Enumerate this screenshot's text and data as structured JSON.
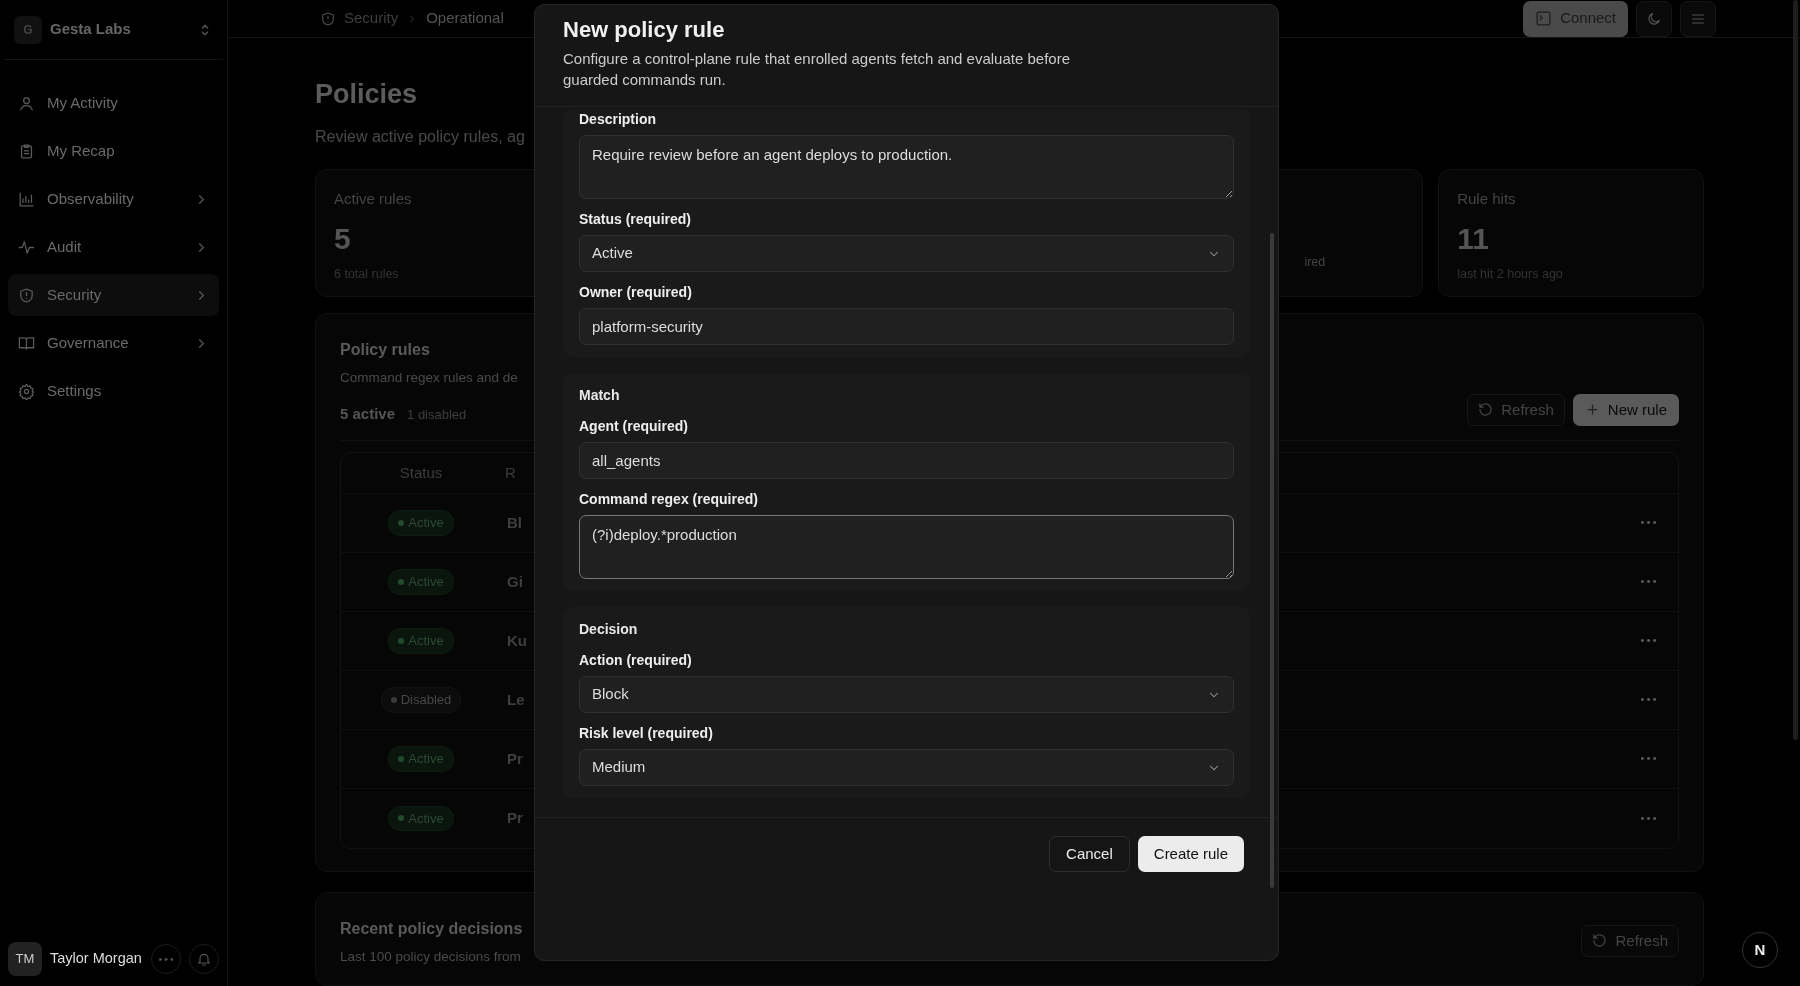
{
  "sidebar": {
    "workspace": {
      "initial": "G",
      "name": "Gesta Labs"
    },
    "items": [
      {
        "label": "My Activity",
        "selected": false,
        "has_submenu": false
      },
      {
        "label": "My Recap",
        "selected": false,
        "has_submenu": false
      },
      {
        "label": "Observability",
        "selected": false,
        "has_submenu": true
      },
      {
        "label": "Audit",
        "selected": false,
        "has_submenu": true
      },
      {
        "label": "Security",
        "selected": true,
        "has_submenu": true
      },
      {
        "label": "Governance",
        "selected": false,
        "has_submenu": true
      },
      {
        "label": "Settings",
        "selected": false,
        "has_submenu": false
      }
    ],
    "user": {
      "initials": "TM",
      "name": "Taylor Morgan"
    }
  },
  "header": {
    "breadcrumb": [
      "Security",
      "Operational"
    ],
    "connect_label": "Connect"
  },
  "page": {
    "title": "Policies",
    "subtitle": "Review active policy rules, ag"
  },
  "stats": [
    {
      "label": "Active rules",
      "value": "5",
      "note": "6 total rules"
    },
    {
      "note": "ired"
    },
    {
      "label": "Rule hits",
      "value": "11",
      "note": "last hit 2 hours ago"
    }
  ],
  "policy_rules": {
    "title": "Policy rules",
    "subtitle": "Command regex rules and de",
    "active_count": "5 active",
    "disabled_count": "1 disabled",
    "buttons": [
      {
        "label": "Refresh",
        "kind": "refresh"
      },
      {
        "label": "New rule",
        "kind": "add"
      }
    ],
    "columns": [
      "Status",
      "R"
    ],
    "rows": [
      {
        "status": "Active",
        "enabled": true,
        "rule": "Bl"
      },
      {
        "status": "Active",
        "enabled": true,
        "rule": "Gi"
      },
      {
        "status": "Active",
        "enabled": true,
        "rule": "Ku"
      },
      {
        "status": "Disabled",
        "enabled": false,
        "rule": "Le"
      },
      {
        "status": "Active",
        "enabled": true,
        "rule": "Pr"
      },
      {
        "status": "Active",
        "enabled": true,
        "rule": "Pr"
      }
    ]
  },
  "recent_decisions": {
    "title": "Recent policy decisions",
    "subtitle": "Last 100 policy decisions from",
    "button": "Refresh"
  },
  "modal": {
    "title": "New policy rule",
    "description": "Configure a control-plane rule that enrolled agents fetch and evaluate before guarded commands run.",
    "sections": [
      {
        "fields": [
          {
            "label": "Description",
            "kind": "textarea",
            "value": "Require review before an agent deploys to production.",
            "focused": false
          },
          {
            "label": "Status (required)",
            "kind": "select",
            "value": "Active",
            "focused": false
          },
          {
            "label": "Owner (required)",
            "kind": "input",
            "value": "platform-security",
            "focused": false
          }
        ]
      },
      {
        "title": "Match",
        "fields": [
          {
            "label": "Agent (required)",
            "kind": "input",
            "value": "all_agents",
            "focused": false
          },
          {
            "label": "Command regex (required)",
            "kind": "textarea",
            "value": "(?i)deploy.*production",
            "focused": true
          }
        ]
      },
      {
        "title": "Decision",
        "fields": [
          {
            "label": "Action (required)",
            "kind": "select",
            "value": "Block",
            "focused": false
          },
          {
            "label": "Risk level (required)",
            "kind": "select",
            "value": "Medium",
            "focused": false
          }
        ]
      }
    ],
    "buttons": [
      {
        "label": "Cancel",
        "kind": "secondary"
      },
      {
        "label": "Create rule",
        "kind": "primary"
      }
    ]
  },
  "dev_indicator": "N"
}
